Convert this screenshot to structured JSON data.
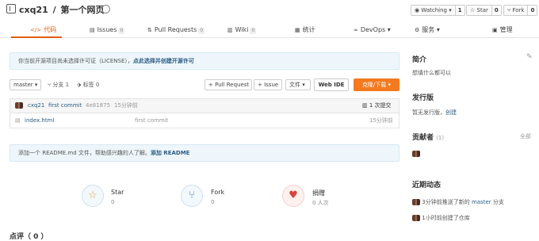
{
  "repo": {
    "owner": "cxq21",
    "separator": "/",
    "name": "第一个网页"
  },
  "actions": {
    "watch": {
      "label": "Watching",
      "count": "1"
    },
    "star": {
      "label": "Star",
      "count": "0"
    },
    "fork": {
      "label": "Fork",
      "count": "0"
    }
  },
  "tabs": [
    {
      "label": "代码"
    },
    {
      "label": "Issues",
      "badge": "0"
    },
    {
      "label": "Pull Requests",
      "badge": "0"
    },
    {
      "label": "Wiki",
      "badge": "0"
    },
    {
      "label": "统计"
    },
    {
      "label": "DevOps"
    },
    {
      "label": "服务"
    },
    {
      "label": "管理"
    }
  ],
  "license_notice": {
    "text": "你当前开源项目尚未选择许可证（LICENSE），",
    "link": "点此选择并创建开源许可"
  },
  "toolbar": {
    "branch": "master",
    "branches": "分支 1",
    "tags": "标签 0",
    "pull_request": "+ Pull Request",
    "issue": "+ Issue",
    "file": "文件",
    "web_ide": "Web IDE",
    "clone": "克隆/下载"
  },
  "commit": {
    "author": "cxq21",
    "message": "first commit",
    "hash": "4e81875",
    "time": "15分钟前",
    "count": "1 次提交"
  },
  "files": [
    {
      "name": "index.html",
      "message": "first commit",
      "time": "15分钟前"
    }
  ],
  "readme_notice": {
    "text": "添加一个 README.md 文件，帮助感兴趣的人了解。",
    "link": "添加 README"
  },
  "stats": {
    "star": {
      "label": "Star",
      "value": "0"
    },
    "fork": {
      "label": "Fork",
      "value": "0"
    },
    "donate": {
      "label": "捐赠",
      "value": "0 人次"
    }
  },
  "comments": {
    "title": "点评（ 0 ）"
  },
  "sidebar": {
    "intro": {
      "title": "简介",
      "text": "想填什么都可以"
    },
    "release": {
      "title": "发行版",
      "text": "暂无发行版，",
      "link": "创建"
    },
    "contributors": {
      "title": "贡献者",
      "count": "(1)",
      "all": "全部"
    },
    "activity": {
      "title": "近期动态",
      "items": [
        {
          "text": "3分钟前推送了新的",
          "branch": "master",
          "suffix": "分支"
        },
        {
          "text": "1小时前创建了仓库"
        }
      ]
    }
  },
  "colors": {
    "accent": "#e35d0a",
    "orange_button": "#f4791f",
    "link": "#2a5d84",
    "notice_bg": "#eef6fb"
  }
}
